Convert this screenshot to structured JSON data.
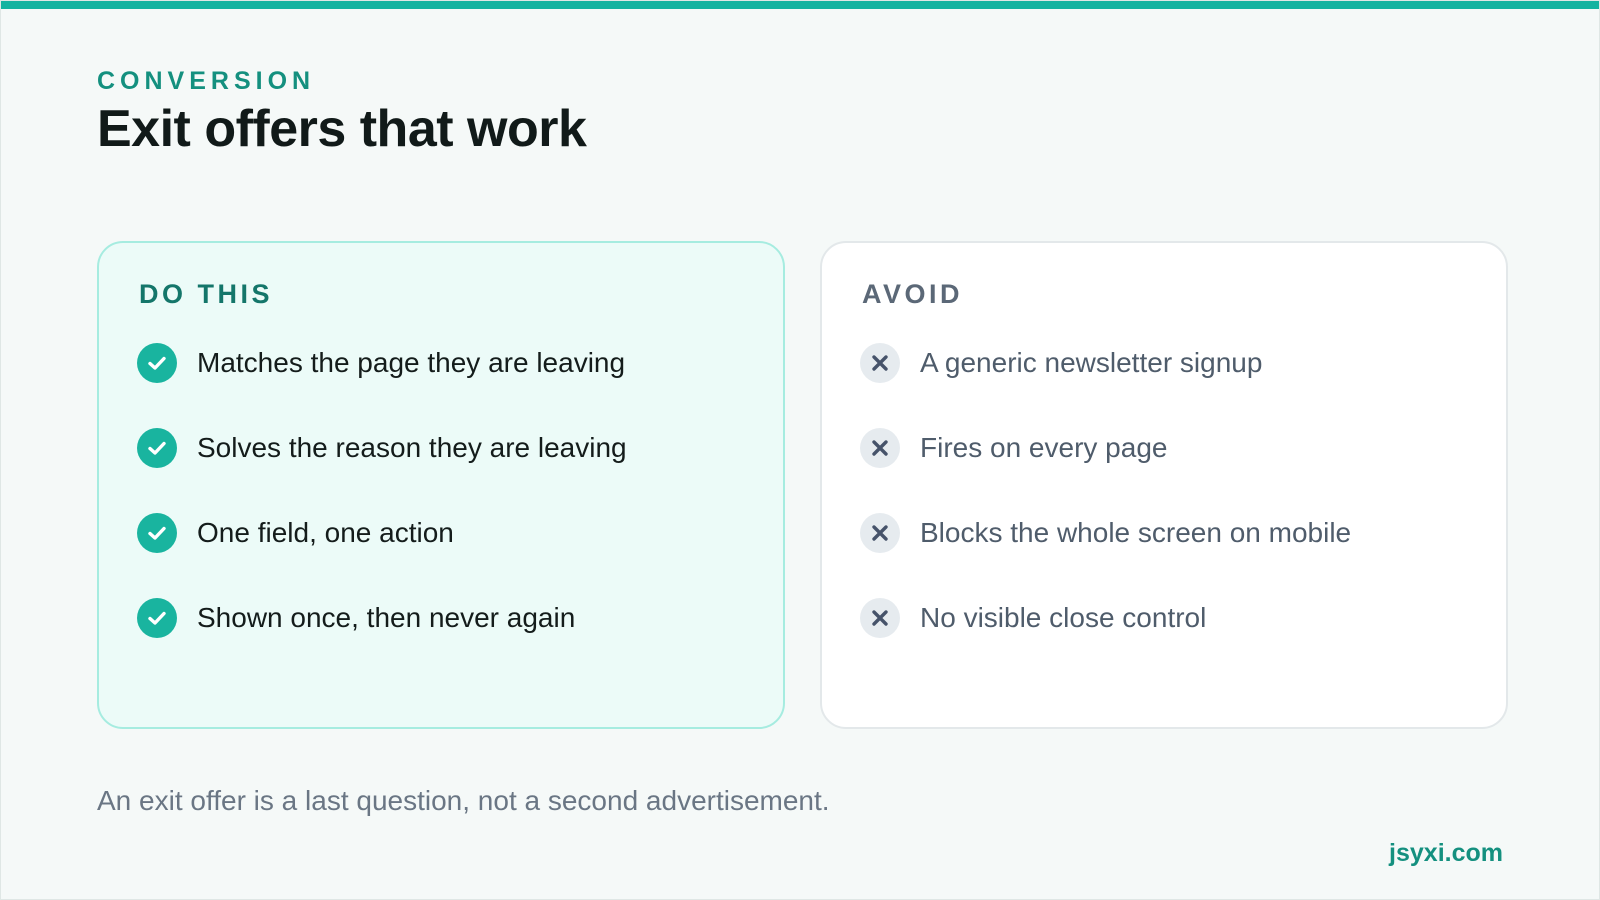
{
  "slide": {
    "eyebrow": "CONVERSION",
    "title": "Exit offers that work",
    "accent_color": "#14b3a0"
  },
  "do_card": {
    "heading": "DO THIS",
    "icon": "check-circle-icon",
    "items": [
      "Matches the page they are leaving",
      "Solves the reason they are leaving",
      "One field, one action",
      "Shown once, then never again"
    ]
  },
  "avoid_card": {
    "heading": "AVOID",
    "icon": "x-circle-icon",
    "items": [
      "A generic newsletter signup",
      "Fires on every page",
      "Blocks the whole screen on mobile",
      "No visible close control"
    ]
  },
  "footnote": "An exit offer is a last question, not a second advertisement.",
  "brand": "jsyxi.com"
}
